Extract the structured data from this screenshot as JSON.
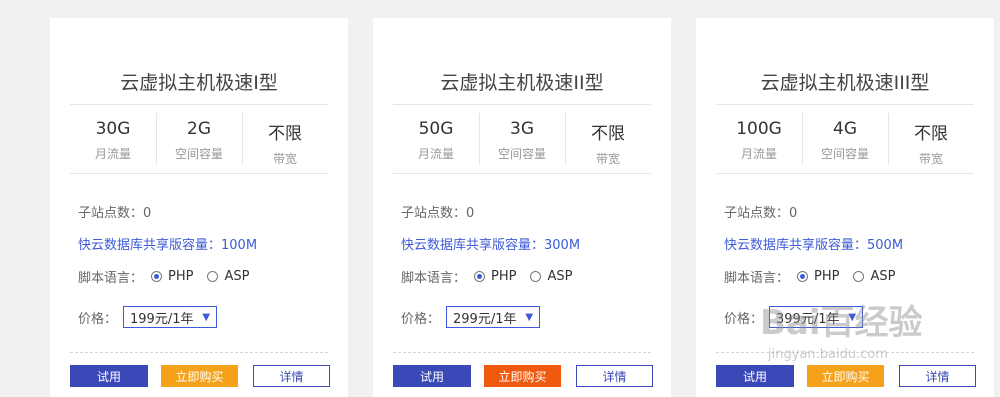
{
  "cards": [
    {
      "title": "云虚拟主机极速I型",
      "specs": [
        {
          "value": "30G",
          "label": "月流量"
        },
        {
          "value": "2G",
          "label": "空间容量"
        },
        {
          "value": "不限",
          "label": "带宽"
        }
      ],
      "sub_sites": "子站点数：0",
      "database": "快云数据库共享版容量：100M",
      "lang_label": "脚本语言：",
      "lang_php": "PHP",
      "lang_asp": "ASP",
      "price_label": "价格：",
      "price_value": "199元/1年",
      "btn_try": "试用",
      "btn_buy": "立即购买",
      "btn_detail": "详情",
      "buy_color": "#f5a11a"
    },
    {
      "title": "云虚拟主机极速II型",
      "specs": [
        {
          "value": "50G",
          "label": "月流量"
        },
        {
          "value": "3G",
          "label": "空间容量"
        },
        {
          "value": "不限",
          "label": "带宽"
        }
      ],
      "sub_sites": "子站点数：0",
      "database": "快云数据库共享版容量：300M",
      "lang_label": "脚本语言：",
      "lang_php": "PHP",
      "lang_asp": "ASP",
      "price_label": "价格：",
      "price_value": "299元/1年",
      "btn_try": "试用",
      "btn_buy": "立即购买",
      "btn_detail": "详情",
      "buy_color": "#f05a0f"
    },
    {
      "title": "云虚拟主机极速III型",
      "specs": [
        {
          "value": "100G",
          "label": "月流量"
        },
        {
          "value": "4G",
          "label": "空间容量"
        },
        {
          "value": "不限",
          "label": "带宽"
        }
      ],
      "sub_sites": "子站点数：0",
      "database": "快云数据库共享版容量：500M",
      "lang_label": "脚本语言：",
      "lang_php": "PHP",
      "lang_asp": "ASP",
      "price_label": "价格：",
      "price_value": "399元/1年",
      "btn_try": "试用",
      "btn_buy": "立即购买",
      "btn_detail": "详情",
      "buy_color": "#f5a11a"
    }
  ],
  "watermark": {
    "text": "Bai百经验",
    "url": "jingyan.baidu.com"
  }
}
